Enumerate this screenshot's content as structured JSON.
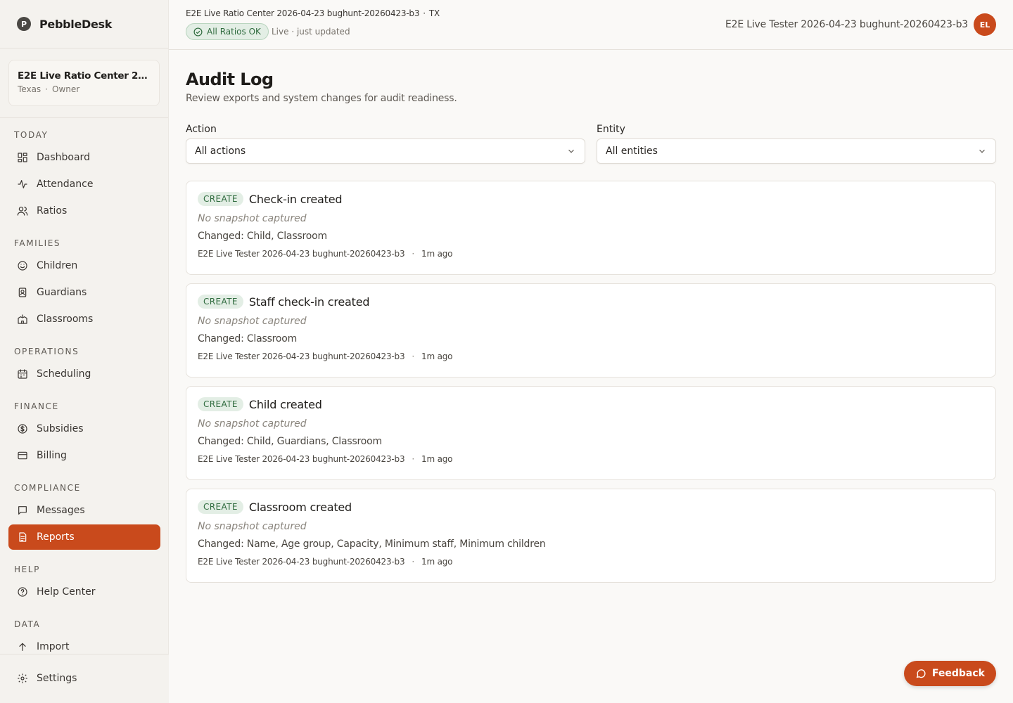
{
  "brand": {
    "logo_letter": "P",
    "name": "PebbleDesk"
  },
  "org": {
    "name": "E2E Live Ratio Center 2026-04-23 bughunt-20260423-b3",
    "state": "Texas",
    "role": "Owner",
    "separator": "·"
  },
  "nav": {
    "sections": [
      {
        "label": "TODAY",
        "items": [
          {
            "label": "Dashboard",
            "icon": "dashboard-icon"
          },
          {
            "label": "Attendance",
            "icon": "activity-icon"
          },
          {
            "label": "Ratios",
            "icon": "users-icon"
          }
        ]
      },
      {
        "label": "FAMILIES",
        "items": [
          {
            "label": "Children",
            "icon": "smile-icon"
          },
          {
            "label": "Guardians",
            "icon": "contact-icon"
          },
          {
            "label": "Classrooms",
            "icon": "school-icon"
          }
        ]
      },
      {
        "label": "OPERATIONS",
        "items": [
          {
            "label": "Scheduling",
            "icon": "calendar-icon"
          }
        ]
      },
      {
        "label": "FINANCE",
        "items": [
          {
            "label": "Subsidies",
            "icon": "dollar-icon"
          },
          {
            "label": "Billing",
            "icon": "credit-card-icon"
          }
        ]
      },
      {
        "label": "COMPLIANCE",
        "items": [
          {
            "label": "Messages",
            "icon": "message-icon"
          },
          {
            "label": "Reports",
            "icon": "report-icon",
            "active": true
          }
        ]
      },
      {
        "label": "HELP",
        "items": [
          {
            "label": "Help Center",
            "icon": "help-icon"
          }
        ]
      },
      {
        "label": "DATA",
        "items": [
          {
            "label": "Import",
            "icon": "upload-icon"
          }
        ]
      }
    ],
    "settings_label": "Settings"
  },
  "header": {
    "center_name": "E2E Live Ratio Center 2026-04-23 bughunt-20260423-b3",
    "separator": "·",
    "state_code": "TX",
    "ratio_status": "All Ratios OK",
    "live_status": "Live · just updated",
    "user_name": "E2E Live Tester 2026-04-23 bughunt-20260423-b3",
    "user_initials": "EL"
  },
  "page": {
    "title": "Audit Log",
    "subtitle": "Review exports and system changes for audit readiness."
  },
  "filters": {
    "action": {
      "label": "Action",
      "value": "All actions"
    },
    "entity": {
      "label": "Entity",
      "value": "All entities"
    }
  },
  "entries": [
    {
      "action": "CREATE",
      "title": "Check-in created",
      "snapshot": "No snapshot captured",
      "changed": "Changed: Child, Classroom",
      "actor": "E2E Live Tester 2026-04-23 bughunt-20260423-b3",
      "time": "1m ago"
    },
    {
      "action": "CREATE",
      "title": "Staff check-in created",
      "snapshot": "No snapshot captured",
      "changed": "Changed: Classroom",
      "actor": "E2E Live Tester 2026-04-23 bughunt-20260423-b3",
      "time": "1m ago"
    },
    {
      "action": "CREATE",
      "title": "Child created",
      "snapshot": "No snapshot captured",
      "changed": "Changed: Child, Guardians, Classroom",
      "actor": "E2E Live Tester 2026-04-23 bughunt-20260423-b3",
      "time": "1m ago"
    },
    {
      "action": "CREATE",
      "title": "Classroom created",
      "snapshot": "No snapshot captured",
      "changed": "Changed: Name, Age group, Capacity, Minimum staff, Minimum children",
      "actor": "E2E Live Tester 2026-04-23 bughunt-20260423-b3",
      "time": "1m ago"
    }
  ],
  "meta_separator": "·",
  "feedback": {
    "label": "Feedback"
  },
  "colors": {
    "accent": "#c94a1c",
    "success": "#2f6b3e",
    "success_bg": "#e3eee5"
  }
}
